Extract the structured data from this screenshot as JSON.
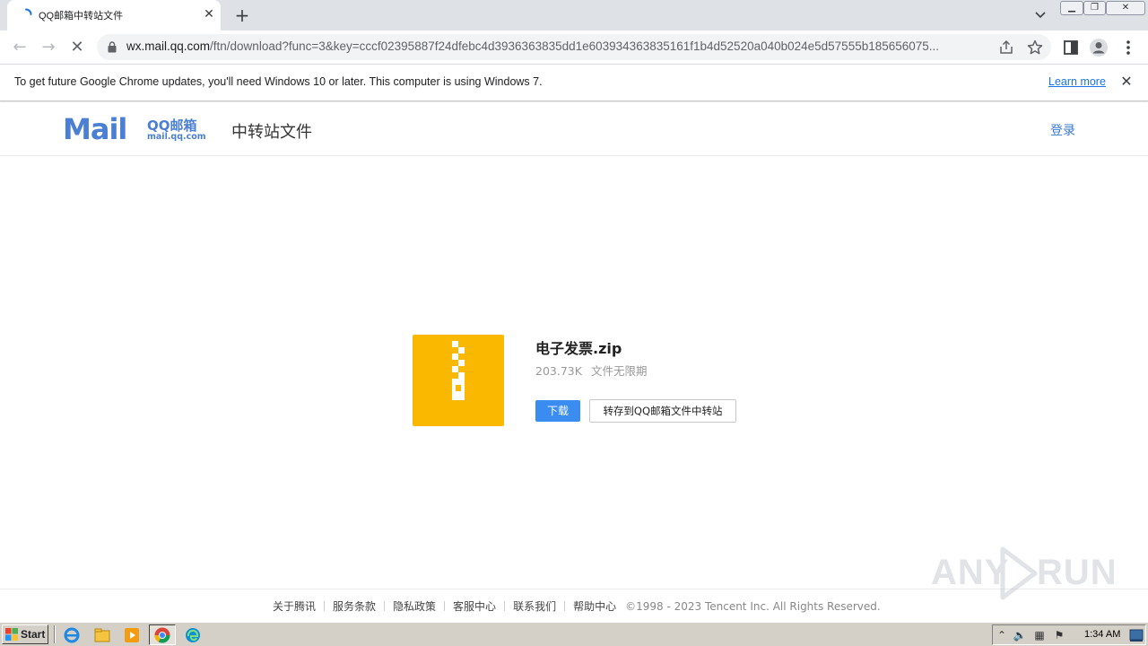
{
  "browser": {
    "tab_title": "QQ邮箱中转站文件",
    "url_host": "wx.mail.qq.com",
    "url_path": "/ftn/download?func=3&key=cccf02395887f24dfebc4d3936363835dd1e603934363835161f1b4d52520a040b024e5d57555b185656075..."
  },
  "infobar": {
    "message": "To get future Google Chrome updates, you'll need Windows 10 or later. This computer is using Windows 7.",
    "link_label": "Learn more"
  },
  "header": {
    "logo_mail": "Mail",
    "logo_qq": "QQ邮箱",
    "logo_domain": "mail.qq.com",
    "title": "中转站文件",
    "login_label": "登录"
  },
  "file": {
    "name": "电子发票.zip",
    "size": "203.73K",
    "expiry": "文件无限期",
    "download_label": "下载",
    "save_label": "转存到QQ邮箱文件中转站"
  },
  "footer": {
    "links": [
      "关于腾讯",
      "服务条款",
      "隐私政策",
      "客服中心",
      "联系我们",
      "帮助中心"
    ],
    "copyright": "©1998 - 2023 Tencent Inc. All Rights Reserved."
  },
  "watermark": {
    "left": "ANY",
    "right": "RUN"
  },
  "taskbar": {
    "start_label": "Start",
    "clock": "1:34 AM"
  },
  "colors": {
    "accent": "#3b8cf0",
    "file_icon": "#fbb800",
    "logo_blue": "#4a7fd4",
    "link_blue": "#1a73e8"
  }
}
